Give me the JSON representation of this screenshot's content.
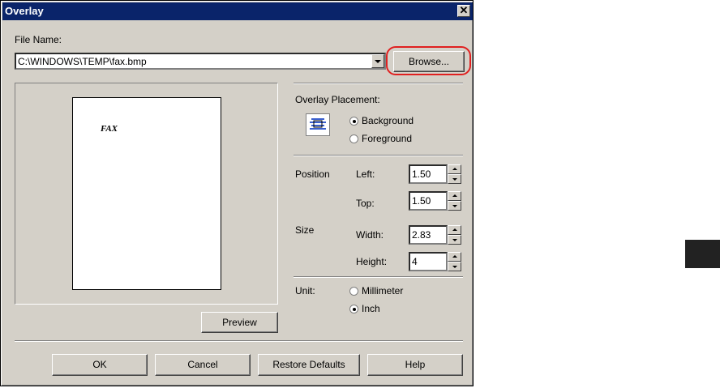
{
  "window": {
    "title": "Overlay",
    "close_label": "✕"
  },
  "file": {
    "label": "File Name:",
    "path": "C:\\WINDOWS\\TEMP\\fax.bmp",
    "browse_label": "Browse..."
  },
  "preview": {
    "page_text": "FAX",
    "button_label": "Preview"
  },
  "placement": {
    "label": "Overlay Placement:",
    "options": [
      {
        "label": "Background",
        "selected": true
      },
      {
        "label": "Foreground",
        "selected": false
      }
    ]
  },
  "position": {
    "label": "Position",
    "left_label": "Left:",
    "left_value": "1.50",
    "top_label": "Top:",
    "top_value": "1.50"
  },
  "size": {
    "label": "Size",
    "width_label": "Width:",
    "width_value": "2.83",
    "height_label": "Height:",
    "height_value": "4"
  },
  "unit": {
    "label": "Unit:",
    "options": [
      {
        "label": "Millimeter",
        "selected": false
      },
      {
        "label": "Inch",
        "selected": true
      }
    ]
  },
  "buttons": {
    "ok": "OK",
    "cancel": "Cancel",
    "restore": "Restore Defaults",
    "help": "Help"
  },
  "colors": {
    "titlebar": "#0a246a",
    "dialog_bg": "#d4d0c8",
    "highlight": "#e02020"
  }
}
